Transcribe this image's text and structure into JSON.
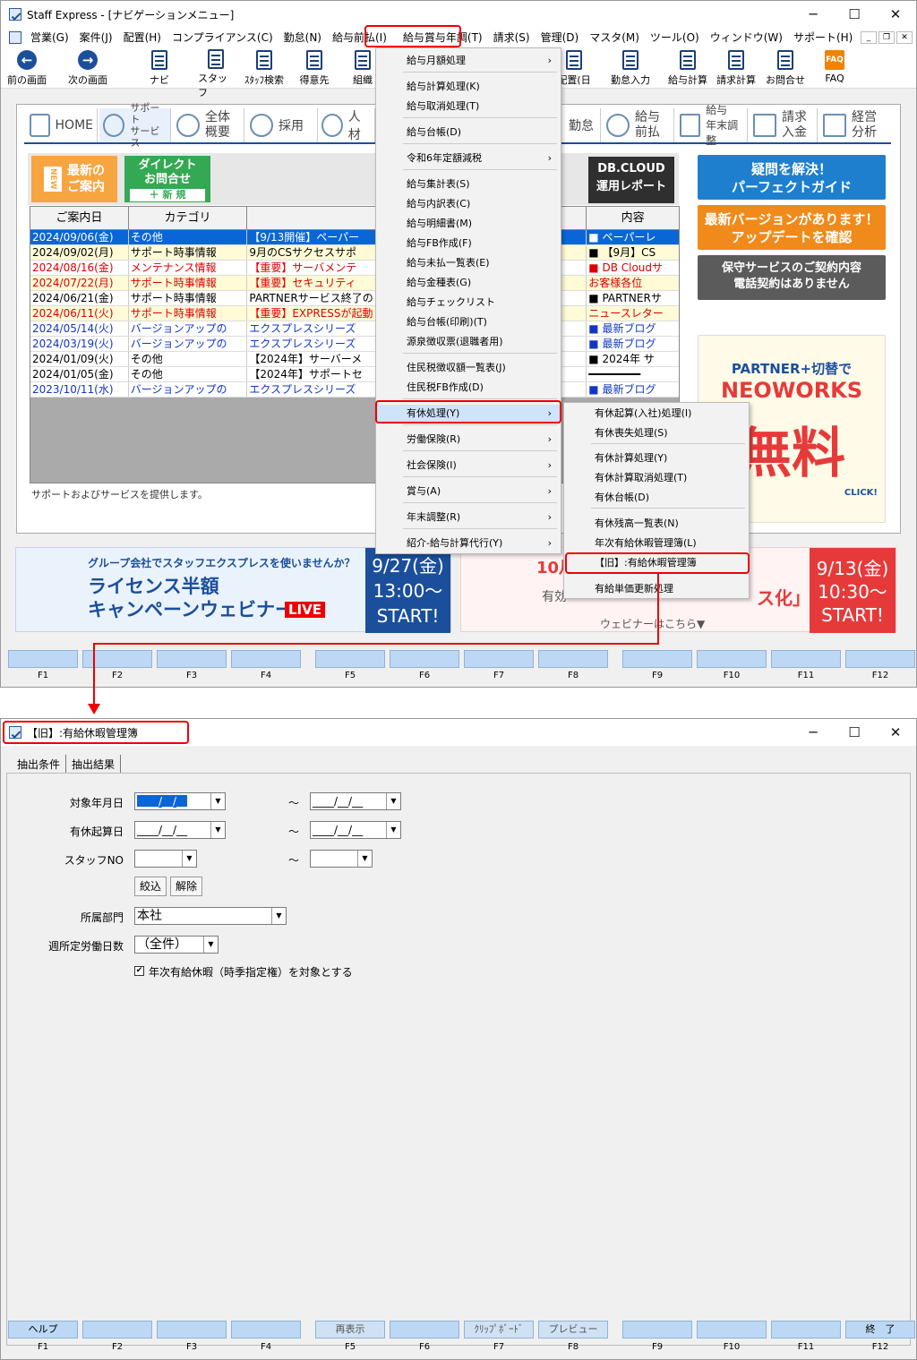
{
  "main_window": {
    "title": "Staff Express - [ナビゲーションメニュー]",
    "controls": {
      "minimize": "─",
      "maximize": "☐",
      "close": "✕"
    },
    "menubar": [
      "営業(G)",
      "案件(J)",
      "配置(H)",
      "コンプライアンス(C)",
      "勤怠(N)",
      "給与前払(I)",
      "給与賞与年調(T)",
      "請求(S)",
      "管理(D)",
      "マスタ(M)",
      "ツール(O)",
      "ウィンドウ(W)",
      "サポート(H)"
    ],
    "toolbar": {
      "back": "前の画面",
      "forward": "次の画面",
      "navi": "ナビ",
      "staff": "スタッフ",
      "staff_search": "ｽﾀｯﾌ検索",
      "client": "得意先",
      "org": "組織",
      "haichi": "配置(日",
      "kintai_input": "勤怠入力",
      "salary_calc": "給与計算",
      "billing_calc": "請求計算",
      "inquiry": "お問合せ",
      "faq": "FAQ",
      "faq_icon_text": "FAQ"
    },
    "navtabs": {
      "home": "HOME",
      "support": "サポート\nサービス",
      "overview": "全体\n概要",
      "recruit": "採用",
      "jinzai": "人材",
      "kintai": "勤怠",
      "salary_adv": "給与\n前払",
      "salary_year": "給与\n年末調整",
      "billing": "請求\n入金",
      "mgmt": "経営\n分析"
    },
    "banners": {
      "new": "最新の\nご案内",
      "new_tag": "NEW",
      "direct": "ダイレクト\nお問合せ",
      "direct_sub": "＋ 新 規",
      "db": "DB.CLOUD\n運用レポート"
    },
    "table": {
      "headers": [
        "ご案内日",
        "カテゴリ",
        "",
        "内容"
      ],
      "rows": [
        {
          "date": "2024/09/06(金)",
          "cat": "その他",
          "title": "【9/13開催】ペーパー",
          "content": "■ ペーパーレ",
          "style": "sel"
        },
        {
          "date": "2024/09/02(月)",
          "cat": "サポート時事情報",
          "title": "9月のCSサクセスサポ",
          "content": "■ 【9月】CS",
          "style": "yl"
        },
        {
          "date": "2024/08/16(金)",
          "cat": "メンテナンス情報",
          "title": "【重要】サーバメンテ",
          "content": "■ DB Cloudサ",
          "style": "red"
        },
        {
          "date": "2024/07/22(月)",
          "cat": "サポート時事情報",
          "title": "【重要】セキュリティ",
          "content": "お客様各位",
          "style": "redyl"
        },
        {
          "date": "2024/06/21(金)",
          "cat": "サポート時事情報",
          "title": "PARTNERサービス終了の",
          "content": "■ PARTNERサ",
          "style": "plain"
        },
        {
          "date": "2024/06/11(火)",
          "cat": "サポート時事情報",
          "title": "【重要】EXPRESSが起動",
          "content": "ニュースレター",
          "style": "redyl"
        },
        {
          "date": "2024/05/14(火)",
          "cat": "バージョンアップの",
          "title": "エクスプレスシリーズ",
          "content": "■ 最新ブログ",
          "style": "blu"
        },
        {
          "date": "2024/03/19(火)",
          "cat": "バージョンアップの",
          "title": "エクスプレスシリーズ",
          "content": "■ 最新ブログ",
          "style": "blu"
        },
        {
          "date": "2024/01/09(火)",
          "cat": "その他",
          "title": "【2024年】サーバーメ",
          "content": "■ 2024年 サ",
          "style": "plain"
        },
        {
          "date": "2024/01/05(金)",
          "cat": "その他",
          "title": "【2024年】サポートセ",
          "content": "━━━━━━━━",
          "style": "plain"
        },
        {
          "date": "2023/10/11(水)",
          "cat": "バージョンアップの",
          "title": "エクスプレスシリーズ",
          "content": "■ 最新ブログ",
          "style": "blu"
        }
      ]
    },
    "status_text": "サポートおよびサービスを提供します。",
    "ads": {
      "guide": "疑問を解決！\nパーフェクトガイド",
      "update": "最新バージョンがあります！\nアップデートを確認",
      "contract": "保守サービスのご契約内容\n電話契約はありません",
      "neoworks": "PARTNER+切替で",
      "neoworks_brand": "NEOWORKS",
      "neoworks_free": "無料",
      "neoworks_click": "CLICK!"
    },
    "bottom_banner1": {
      "text": "グループ会社でスタッフエクスプレスを使いませんか？",
      "main": "ライセンス半額\nキャンペーンウェビナー",
      "live": "LIVE",
      "date": "9/27(金)\n13:00～\nSTART!"
    },
    "bottom_banner2": {
      "head": "10月",
      "text": "有効",
      "main": "ス化」",
      "sub": "ウェビナーはこちら▼",
      "date": "9/13(金)\n10:30～\nSTART!"
    },
    "fkeys": [
      "F1",
      "F2",
      "F3",
      "F4",
      "F5",
      "F6",
      "F7",
      "F8",
      "F9",
      "F10",
      "F11",
      "F12"
    ]
  },
  "dropdown_menu": {
    "items": [
      "給与月額処理",
      "給与計算処理(K)",
      "給与取消処理(T)",
      "給与台帳(D)",
      "令和6年定額減税",
      "給与集計表(S)",
      "給与内訳表(C)",
      "給与明細書(M)",
      "給与FB作成(F)",
      "給与未払一覧表(E)",
      "給与金種表(G)",
      "給与チェックリスト",
      "給与台帳(印刷)(T)",
      "源泉徴収票(退職者用)",
      "住民税徴収額一覧表(J)",
      "住民税FB作成(D)",
      "有休処理(Y)",
      "労働保険(R)",
      "社会保険(I)",
      "賞与(A)",
      "年末調整(R)",
      "紹介-給与計算代行(Y)"
    ]
  },
  "submenu": {
    "items": [
      "有休起算(入社)処理(I)",
      "有休喪失処理(S)",
      "有休計算処理(Y)",
      "有休計算取消処理(T)",
      "有休台帳(D)",
      "有休残高一覧表(N)",
      "年次有給休暇管理簿(L)",
      "【旧】:有給休暇管理簿",
      "有給単価更新処理"
    ]
  },
  "sub_window": {
    "title": "【旧】:有給休暇管理簿",
    "tabs": [
      "抽出条件",
      "抽出結果"
    ],
    "labels": {
      "target_month": "対象年月日",
      "leave_start": "有休起算日",
      "staff_no": "スタッフNO",
      "dept": "所属部門",
      "weekly_days": "週所定労働日数"
    },
    "date_placeholder": "____/__/__",
    "tilde": "～",
    "buttons": {
      "filter": "絞込",
      "clear": "解除"
    },
    "dept_value": "本社",
    "weekly_value": "（全件）",
    "checkbox_label": "年次有給休暇（時季指定権）を対象とする",
    "checkbox_checked": "✔",
    "fkey_labels": [
      "ヘルプ",
      "",
      "",
      "",
      "再表示",
      "",
      "ｸﾘｯﾌﾟﾎﾞｰﾄﾞ",
      "プレビュー",
      "",
      "",
      "",
      "終　了"
    ],
    "fkeys": [
      "F1",
      "F2",
      "F3",
      "F4",
      "F5",
      "F6",
      "F7",
      "F8",
      "F9",
      "F10",
      "F11",
      "F12"
    ]
  },
  "colors": {
    "accent": "#1b4f9c",
    "highlight": "#e00000",
    "fkey": "#bcd8f4",
    "selected_row": "#0a66d6"
  }
}
